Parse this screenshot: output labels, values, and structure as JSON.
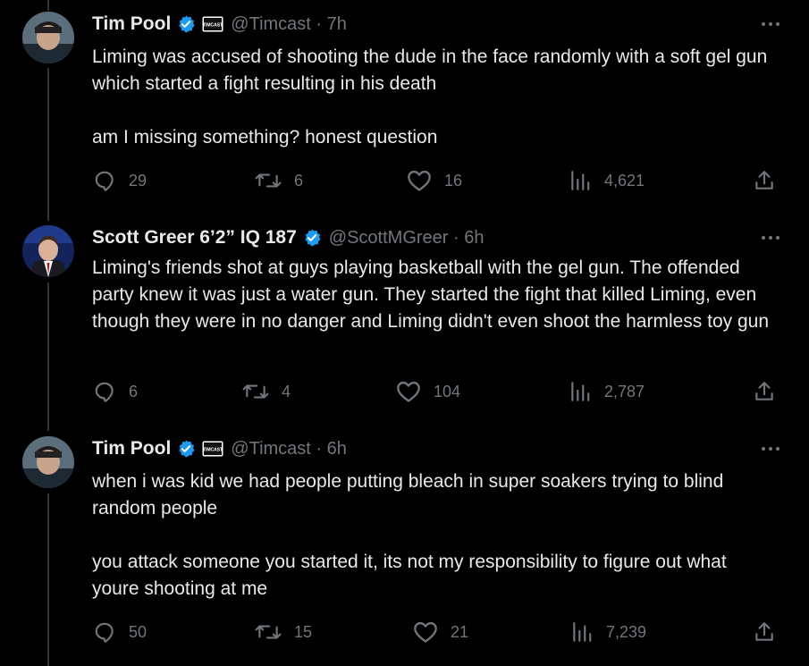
{
  "tweets": [
    {
      "name": "Tim Pool",
      "handle": "@Timcast",
      "time": "7h",
      "affiliation_badge": "TIMCAST",
      "text": "Liming was accused of shooting the dude in the face randomly with a soft gel gun which started a fight resulting in his death\n\nam I missing something? honest question",
      "replies": "29",
      "reposts": "6",
      "likes": "16",
      "views": "4,621"
    },
    {
      "name": "Scott Greer 6’2” IQ 187",
      "handle": "@ScottMGreer",
      "time": "6h",
      "text": "Liming's friends shot at guys playing basketball with the gel gun. The offended party knew it was just a water gun. They started the fight that killed Liming, even though they were in no danger and Liming didn't even shoot the harmless toy gun",
      "replies": "6",
      "reposts": "4",
      "likes": "104",
      "views": "2,787"
    },
    {
      "name": "Tim Pool",
      "handle": "@Timcast",
      "time": "6h",
      "affiliation_badge": "TIMCAST",
      "text": "when i was kid we had people putting bleach in super soakers trying to blind random people\n\nyou attack someone you started it, its not my responsibility to figure out what youre shooting at me",
      "replies": "50",
      "reposts": "15",
      "likes": "21",
      "views": "7,239"
    }
  ],
  "separator": " · ",
  "icons": [
    "more-icon",
    "verified-badge-icon",
    "reply-icon",
    "repost-icon",
    "like-icon",
    "views-icon",
    "share-icon"
  ],
  "colors": {
    "background": "#000000",
    "text": "#e7e9ea",
    "secondary": "#71767b",
    "verified": "#1d9bf0",
    "thread_line": "#333639"
  }
}
